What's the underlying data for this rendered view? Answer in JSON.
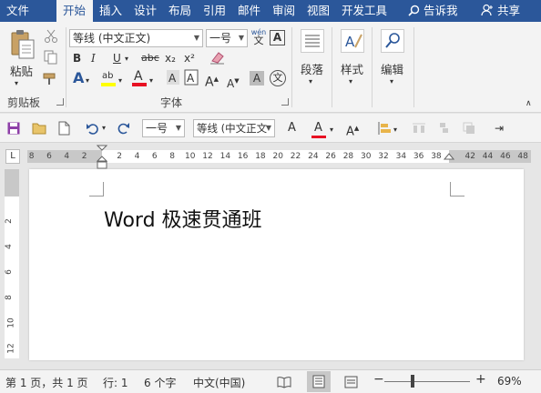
{
  "tabs": [
    "文件",
    "开始",
    "插入",
    "设计",
    "布局",
    "引用",
    "邮件",
    "审阅",
    "视图",
    "开发工具"
  ],
  "tell_me": "告诉我",
  "share": "共享",
  "clipboard": {
    "paste": "粘贴",
    "group": "剪贴板"
  },
  "font": {
    "name": "等线 (中文正文)",
    "size": "一号",
    "wen": "wén",
    "wen_char": "文",
    "bold": "B",
    "italic": "I",
    "underline": "U",
    "strike": "abc",
    "subscript": "x₂",
    "superscript": "x²",
    "group": "字体",
    "font_color_glyph": "A",
    "grow": "A",
    "shrink": "A",
    "highlight_glyph": "ab"
  },
  "paragraph": {
    "label": "段落"
  },
  "styles": {
    "label": "样式"
  },
  "editing": {
    "label": "编辑"
  },
  "qat": {
    "size": "一号",
    "font": "等线 (中文正文"
  },
  "ruler": {
    "left_numbers": [
      "8",
      "6",
      "4",
      "2"
    ],
    "right_numbers": [
      "2",
      "4",
      "6",
      "8",
      "10",
      "12",
      "14",
      "16",
      "18",
      "20",
      "22",
      "24",
      "26",
      "28",
      "30",
      "32",
      "34",
      "36",
      "38"
    ],
    "far_right_numbers": [
      "42",
      "44",
      "46",
      "48"
    ],
    "tab_glyph": "L"
  },
  "vruler_numbers": [
    "2",
    "4",
    "6",
    "8",
    "10",
    "12"
  ],
  "document": {
    "text": "Word 极速贯通班"
  },
  "status": {
    "page": "第 1 页，共 1 页",
    "line": "行: 1",
    "words": "6 个字",
    "lang": "中文(中国)",
    "zoom": "69%",
    "zoom_level": 0.69
  },
  "colors": {
    "accent": "#2b579a",
    "font_red": "#e81123",
    "highlight": "#ffff00"
  }
}
